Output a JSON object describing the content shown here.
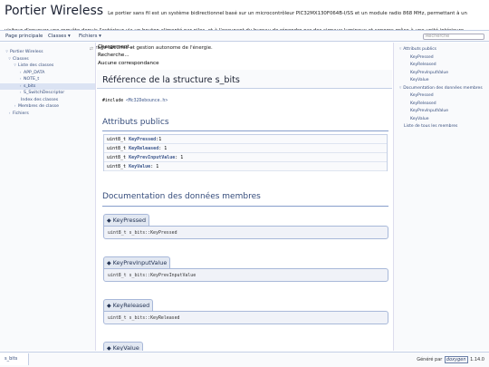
{
  "project": {
    "name": "Portier Wireless",
    "brief": "Le portier sans fil est un système bidirectionnel basé sur un microcontrôleur PIC32MX130F064B-I/SS et un module radio 868 MHz, permettant à un visiteur d'envoyer une requête depuis l'extérieur via un bouton alimenté par piles, et à l'occupant du bureau de répondre par des signaux lumineux et sonores grâce à une unité intérieure alimentée en USB, le tout avec appairage sécurisé et gestion autonome de l'énergie."
  },
  "tabs": [
    "Page principale",
    "Classes",
    "Fichiers"
  ],
  "search": {
    "placeholder": "Recherche"
  },
  "nav_tree": [
    {
      "label": "Portier Wireless",
      "arrow": "▿"
    },
    {
      "label": "Classes",
      "arrow": "▿"
    },
    {
      "label": "Liste des classes",
      "arrow": "▿"
    },
    {
      "label": "APP_DATA",
      "arrow": "›"
    },
    {
      "label": "NOTE_t",
      "arrow": "›"
    },
    {
      "label": "s_bits",
      "arrow": "›"
    },
    {
      "label": "S_SwitchDescriptor",
      "arrow": "›"
    },
    {
      "label": "Index des classes",
      "arrow": ""
    },
    {
      "label": "Membres de classe",
      "arrow": "›"
    },
    {
      "label": "Fichiers",
      "arrow": "›"
    }
  ],
  "status": [
    "Chargement...",
    "Recherche...",
    "Aucune correspondance"
  ],
  "page_title": "Référence de la structure s_bits",
  "include": {
    "prefix": "#include ",
    "file": "<Mc32Debounce.h>"
  },
  "sections": {
    "public_attrs": "Attributs publics",
    "member_doc": "Documentation des données membres"
  },
  "attributes": [
    {
      "type": "uint8_t ",
      "name": "KeyPressed",
      "bits": ":1"
    },
    {
      "type": "uint8_t ",
      "name": "KeyReleased",
      "bits": ": 1"
    },
    {
      "type": "uint8_t ",
      "name": "KeyPrevInputValue",
      "bits": ": 1"
    },
    {
      "type": "uint8_t ",
      "name": "KeyValue",
      "bits": ": 1"
    }
  ],
  "members": [
    {
      "bullet": "◆",
      "title": "KeyPressed",
      "proto": "uint8_t s_bits::KeyPressed"
    },
    {
      "bullet": "◆",
      "title": "KeyPrevInputValue",
      "proto": "uint8_t s_bits::KeyPrevInputValue"
    },
    {
      "bullet": "◆",
      "title": "KeyReleased",
      "proto": "uint8_t s_bits::KeyReleased"
    },
    {
      "bullet": "◆",
      "title": "KeyValue",
      "proto": ""
    }
  ],
  "right_nav": [
    {
      "label": "Attributs publics",
      "arrow": "▿"
    },
    {
      "label": "KeyPressed",
      "arrow": ""
    },
    {
      "label": "KeyReleased",
      "arrow": ""
    },
    {
      "label": "KeyPrevInputValue",
      "arrow": ""
    },
    {
      "label": "KeyValue",
      "arrow": ""
    },
    {
      "label": "Documentation des données membres",
      "arrow": "▿"
    },
    {
      "label": "KeyPressed",
      "arrow": ""
    },
    {
      "label": "KeyReleased",
      "arrow": ""
    },
    {
      "label": "KeyPrevInputValue",
      "arrow": ""
    },
    {
      "label": "KeyValue",
      "arrow": ""
    },
    {
      "label": "Liste de tous les membres",
      "arrow": ""
    }
  ],
  "footer": {
    "crumb": "s_bits",
    "generated_prefix": "Généré par ",
    "logo": "doxygen",
    "version": " 1.14.0"
  }
}
